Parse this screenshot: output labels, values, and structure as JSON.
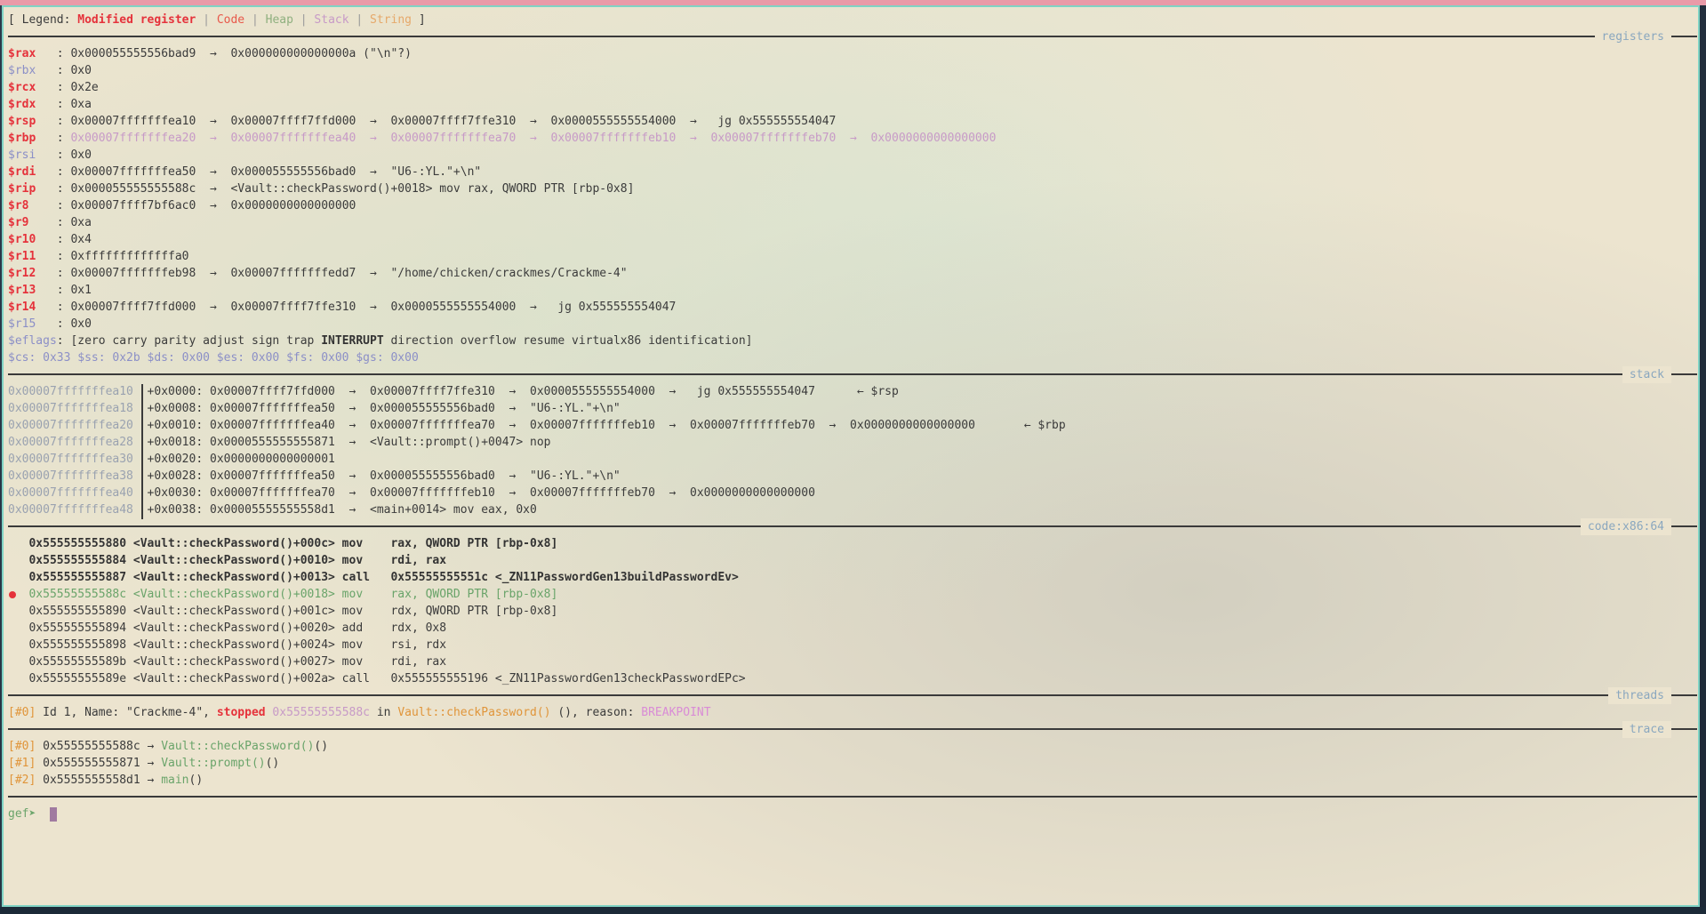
{
  "legend": {
    "open": "[ Legend: ",
    "modified": "Modified register",
    "sep": " | ",
    "code": "Code",
    "heap": "Heap",
    "stack": "Stack",
    "string": "String",
    "close": " ]"
  },
  "sections": {
    "registers": "registers",
    "stack": "stack",
    "code": "code:x86:64",
    "threads": "threads",
    "trace": "trace"
  },
  "registers": [
    {
      "name": "$rax",
      "text": "0x000055555556bad9  →  0x000000000000000a (\"\\n\"?)"
    },
    {
      "name": "$rbx",
      "text": "0x0"
    },
    {
      "name": "$rcx",
      "text": "0x2e"
    },
    {
      "name": "$rdx",
      "text": "0xa"
    },
    {
      "name": "$rsp",
      "text": "0x00007fffffffea10  →  0x00007ffff7ffd000  →  0x00007ffff7ffe310  →  0x0000555555554000  →   jg 0x555555554047"
    },
    {
      "name": "$rbp",
      "text": "0x00007fffffffea20  →  0x00007fffffffea40  →  0x00007fffffffea70  →  0x00007fffffffeb10  →  0x00007fffffffeb70  →  0x0000000000000000"
    },
    {
      "name": "$rsi",
      "text": "0x0"
    },
    {
      "name": "$rdi",
      "text": "0x00007fffffffea50  →  0x000055555556bad0  →  \"U6-:YL.\"+\\n\""
    },
    {
      "name": "$rip",
      "text": "0x000055555555588c  →  <Vault::checkPassword()+0018> mov rax, QWORD PTR [rbp-0x8]"
    },
    {
      "name": "$r8",
      "text": "0x00007ffff7bf6ac0  →  0x0000000000000000"
    },
    {
      "name": "$r9",
      "text": "0xa"
    },
    {
      "name": "$r10",
      "text": "0x4"
    },
    {
      "name": "$r11",
      "text": "0xfffffffffffffa0"
    },
    {
      "name": "$r12",
      "text": "0x00007fffffffeb98  →  0x00007fffffffedd7  →  \"/home/chicken/crackmes/Crackme-4\""
    },
    {
      "name": "$r13",
      "text": "0x1"
    },
    {
      "name": "$r14",
      "text": "0x00007ffff7ffd000  →  0x00007ffff7ffe310  →  0x0000555555554000  →   jg 0x555555554047"
    },
    {
      "name": "$r15",
      "text": "0x0"
    }
  ],
  "eflags": {
    "label": "$eflags",
    "before": ": [zero carry parity adjust sign trap ",
    "bold": "INTERRUPT",
    "after": " direction overflow resume virtualx86 identification]"
  },
  "segments": "$cs: 0x33 $ss: 0x2b $ds: 0x00 $es: 0x00 $fs: 0x00 $gs: 0x00",
  "stack": [
    {
      "addr": "0x00007fffffffea10",
      "text": "+0x0000: 0x00007ffff7ffd000  →  0x00007ffff7ffe310  →  0x0000555555554000  →   jg 0x555555554047      ← $rsp"
    },
    {
      "addr": "0x00007fffffffea18",
      "text": "+0x0008: 0x00007fffffffea50  →  0x000055555556bad0  →  \"U6-:YL.\"+\\n\""
    },
    {
      "addr": "0x00007fffffffea20",
      "text": "+0x0010: 0x00007fffffffea40  →  0x00007fffffffea70  →  0x00007fffffffeb10  →  0x00007fffffffeb70  →  0x0000000000000000       ← $rbp"
    },
    {
      "addr": "0x00007fffffffea28",
      "text": "+0x0018: 0x0000555555555871  →  <Vault::prompt()+0047> nop"
    },
    {
      "addr": "0x00007fffffffea30",
      "text": "+0x0020: 0x0000000000000001"
    },
    {
      "addr": "0x00007fffffffea38",
      "text": "+0x0028: 0x00007fffffffea50  →  0x000055555556bad0  →  \"U6-:YL.\"+\\n\""
    },
    {
      "addr": "0x00007fffffffea40",
      "text": "+0x0030: 0x00007fffffffea70  →  0x00007fffffffeb10  →  0x00007fffffffeb70  →  0x0000000000000000"
    },
    {
      "addr": "0x00007fffffffea48",
      "text": "+0x0038: 0x00005555555558d1  →  <main+0014> mov eax, 0x0"
    }
  ],
  "code": [
    {
      "text": "   0x555555555880 <Vault::checkPassword()+000c> mov    rax, QWORD PTR [rbp-0x8]",
      "kind": "past"
    },
    {
      "text": "   0x555555555884 <Vault::checkPassword()+0010> mov    rdi, rax",
      "kind": "past"
    },
    {
      "text": "   0x555555555887 <Vault::checkPassword()+0013> call   0x55555555551c <_ZN11PasswordGen13buildPasswordEv>",
      "kind": "past"
    },
    {
      "text": "   0x55555555588c <Vault::checkPassword()+0018> mov    rax, QWORD PTR [rbp-0x8]",
      "kind": "current"
    },
    {
      "text": "   0x555555555890 <Vault::checkPassword()+001c> mov    rdx, QWORD PTR [rbp-0x8]",
      "kind": "next"
    },
    {
      "text": "   0x555555555894 <Vault::checkPassword()+0020> add    rdx, 0x8",
      "kind": "next"
    },
    {
      "text": "   0x555555555898 <Vault::checkPassword()+0024> mov    rsi, rdx",
      "kind": "next"
    },
    {
      "text": "   0x55555555589b <Vault::checkPassword()+0027> mov    rdi, rax",
      "kind": "next"
    },
    {
      "text": "   0x55555555589e <Vault::checkPassword()+002a> call   0x555555555196 <_ZN11PasswordGen13checkPasswordEPc>",
      "kind": "next"
    }
  ],
  "thread": {
    "id": "[#0]",
    "pre": " Id 1, Name: \"Crackme-4\", ",
    "stopped": "stopped",
    "addr": " 0x55555555588c",
    "in": " in ",
    "func": "Vault::checkPassword",
    "fn_parens": "()",
    "post": " (), reason: ",
    "reason": "BREAKPOINT"
  },
  "trace": [
    {
      "id": "[#0]",
      "addr": " 0x55555555588c → ",
      "func": "Vault::checkPassword()",
      "tail": "()"
    },
    {
      "id": "[#1]",
      "addr": " 0x555555555871 → ",
      "func": "Vault::prompt()",
      "tail": "()"
    },
    {
      "id": "[#2]",
      "addr": " 0x5555555558d1 → ",
      "func": "main",
      "tail": "()"
    }
  ],
  "prompt": "gef➤  "
}
